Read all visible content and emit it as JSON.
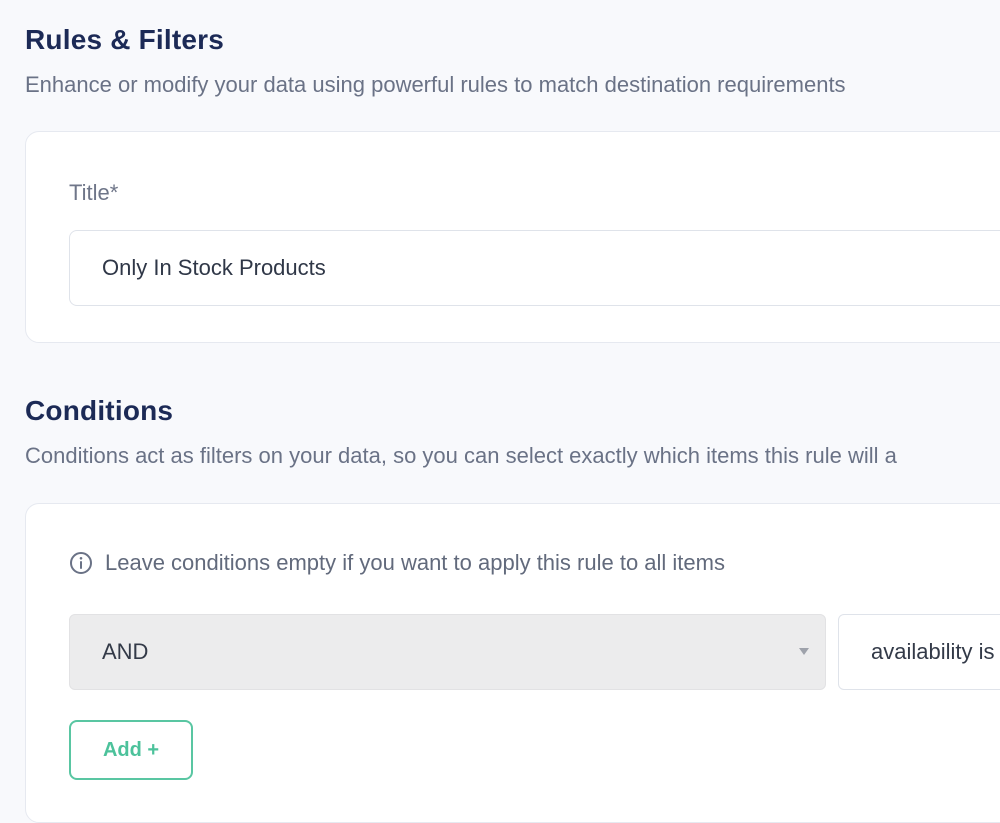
{
  "rules_section": {
    "title": "Rules & Filters",
    "subtitle": "Enhance or modify your data using powerful rules to match destination requirements"
  },
  "title_card": {
    "label": "Title*",
    "value": "Only In Stock Products"
  },
  "conditions_section": {
    "title": "Conditions",
    "subtitle": "Conditions act as filters on your data, so you can select exactly which items this rule will a"
  },
  "conditions_card": {
    "hint": "Leave conditions empty if you want to apply this rule to all items",
    "hint_icon": "info-icon",
    "operator_selected": "AND",
    "condition_text": "availability is",
    "add_label": "Add +"
  },
  "colors": {
    "accent": "#4cc29b",
    "heading": "#1c2a56",
    "muted_text": "#6a7286",
    "background": "#f8f9fc"
  }
}
